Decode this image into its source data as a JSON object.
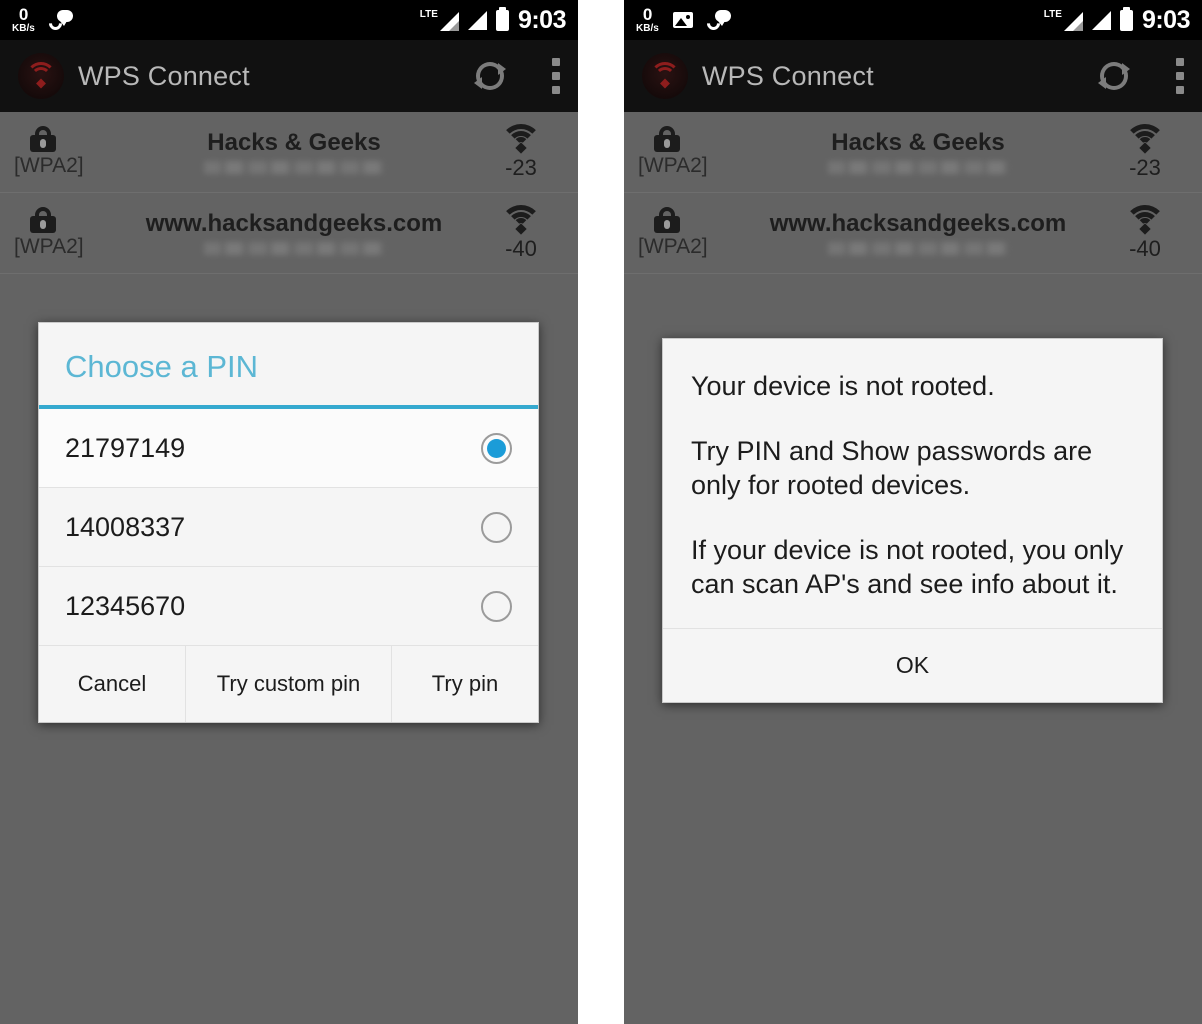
{
  "statusbar": {
    "data_rate_value": "0",
    "data_rate_unit": "KB/s",
    "photo_icon": "photo-icon",
    "call_message_icon": "call-message-icon",
    "network_type": "LTE",
    "signal_icon": "signal-bars-icon",
    "battery_icon": "battery-icon",
    "time": "9:03"
  },
  "appbar": {
    "logo_icon": "wps-connect-logo-icon",
    "title": "WPS Connect",
    "refresh_icon": "refresh-icon",
    "overflow_icon": "overflow-menu-icon"
  },
  "wifi_list": [
    {
      "security": "[WPA2]",
      "ssid": "Hacks & Geeks",
      "bssid": "",
      "rssi": "-23",
      "lock_icon": "lock-icon",
      "wifi_icon": "wifi-signal-icon"
    },
    {
      "security": "[WPA2]",
      "ssid": "www.hacksandgeeks.com",
      "bssid": "",
      "rssi": "-40",
      "lock_icon": "lock-icon",
      "wifi_icon": "wifi-signal-icon"
    }
  ],
  "pin_dialog": {
    "title": "Choose a PIN",
    "options": [
      {
        "pin": "21797149",
        "selected": true
      },
      {
        "pin": "14008337",
        "selected": false
      },
      {
        "pin": "12345670",
        "selected": false
      }
    ],
    "cancel_label": "Cancel",
    "custom_pin_label": "Try custom pin",
    "try_pin_label": "Try pin"
  },
  "root_dialog": {
    "paragraph_1": "Your device is not rooted.",
    "paragraph_2": "Try PIN and Show passwords are only for rooted devices.",
    "paragraph_3": "If your device is not rooted, you only can scan AP's and see info about it.",
    "ok_label": "OK"
  },
  "colors": {
    "accent": "#35a9cf",
    "title_text": "#5cb7d4",
    "radio_selected": "#1b9cd8",
    "scrim": "#636363",
    "appbar": "#111111",
    "statusbar": "#000000",
    "dialog_bg": "#f5f5f5",
    "logo_red": "#8e1d1d"
  }
}
